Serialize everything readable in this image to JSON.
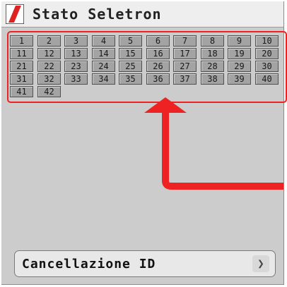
{
  "header": {
    "title": "Stato Seletron",
    "icon": "seletron-logo-icon"
  },
  "grid": {
    "cells": [
      "1",
      "2",
      "3",
      "4",
      "5",
      "6",
      "7",
      "8",
      "9",
      "10",
      "11",
      "12",
      "13",
      "14",
      "15",
      "16",
      "17",
      "18",
      "19",
      "20",
      "21",
      "22",
      "23",
      "24",
      "25",
      "26",
      "27",
      "28",
      "29",
      "30",
      "31",
      "32",
      "33",
      "34",
      "35",
      "36",
      "37",
      "38",
      "39",
      "40",
      "41",
      "42"
    ]
  },
  "footer": {
    "button_label": "Cancellazione ID",
    "button_icon": "chevron-right-icon"
  },
  "colors": {
    "accent": "#ee2222",
    "cell": "#a3a3a3",
    "panel": "#cccccc"
  }
}
